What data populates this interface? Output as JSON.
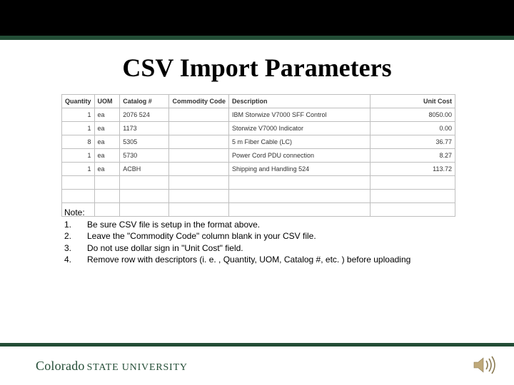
{
  "title": "CSV Import Parameters",
  "table": {
    "headers": [
      "Quantity",
      "UOM",
      "Catalog #",
      "Commodity Code",
      "Description",
      "Unit Cost"
    ],
    "rows": [
      {
        "qty": "1",
        "uom": "ea",
        "catalog": "2076 524",
        "commodity": "",
        "desc": "IBM Storwize V7000 SFF Control",
        "cost": "8050.00"
      },
      {
        "qty": "1",
        "uom": "ea",
        "catalog": "1173",
        "commodity": "",
        "desc": "Storwize V7000 Indicator",
        "cost": "0.00"
      },
      {
        "qty": "8",
        "uom": "ea",
        "catalog": "5305",
        "commodity": "",
        "desc": "5 m Fiber Cable (LC)",
        "cost": "36.77"
      },
      {
        "qty": "1",
        "uom": "ea",
        "catalog": "5730",
        "commodity": "",
        "desc": "Power Cord  PDU connection",
        "cost": "8.27"
      },
      {
        "qty": "1",
        "uom": "ea",
        "catalog": "ACBH",
        "commodity": "",
        "desc": "Shipping and Handling 524",
        "cost": "113.72"
      }
    ]
  },
  "notes": {
    "heading": "Note:",
    "items": [
      "Be sure CSV file is setup in the format above.",
      "Leave the \"Commodity Code\" column blank in your CSV file.",
      "Do not use dollar sign in \"Unit Cost\" field.",
      "Remove row with descriptors (i. e. , Quantity, UOM, Catalog #, etc. ) before uploading"
    ]
  },
  "logo": {
    "part1": "Colorado",
    "part2": "State University"
  },
  "icons": {
    "speaker": "speaker-icon"
  }
}
